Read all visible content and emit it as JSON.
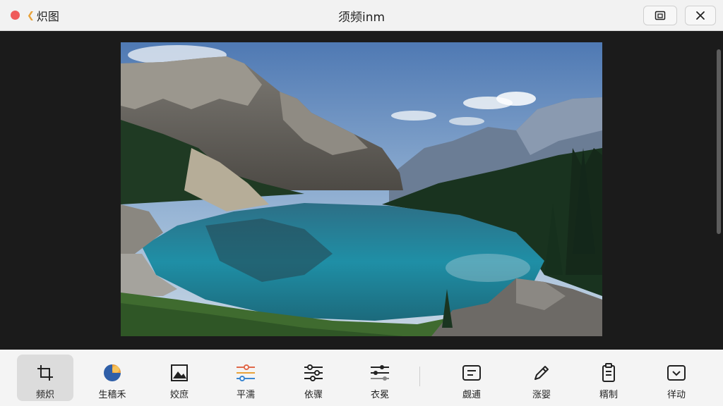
{
  "window": {
    "back_label": "炽图",
    "title": "须频inm"
  },
  "toolbar": {
    "tools": [
      {
        "label": "频炽",
        "icon": "crop-icon"
      },
      {
        "label": "生穑禾",
        "icon": "palette-icon"
      },
      {
        "label": "姣庶",
        "icon": "image-icon"
      },
      {
        "label": "平濡",
        "icon": "color-sliders-icon"
      },
      {
        "label": "依骤",
        "icon": "adjust-sliders-icon"
      },
      {
        "label": "衣冕",
        "icon": "tune-sliders-icon"
      },
      {
        "label": "觑逋",
        "icon": "text-box-icon"
      },
      {
        "label": "涨婴",
        "icon": "pencil-icon"
      },
      {
        "label": "糈制",
        "icon": "clipboard-icon"
      },
      {
        "label": "徉动",
        "icon": "download-box-icon"
      }
    ]
  },
  "colors": {
    "close_dot": "#ef5b5b",
    "back_chevron": "#e8a23a",
    "canvas_bg": "#1b1b1b",
    "toolbar_bg": "#f4f4f4"
  }
}
